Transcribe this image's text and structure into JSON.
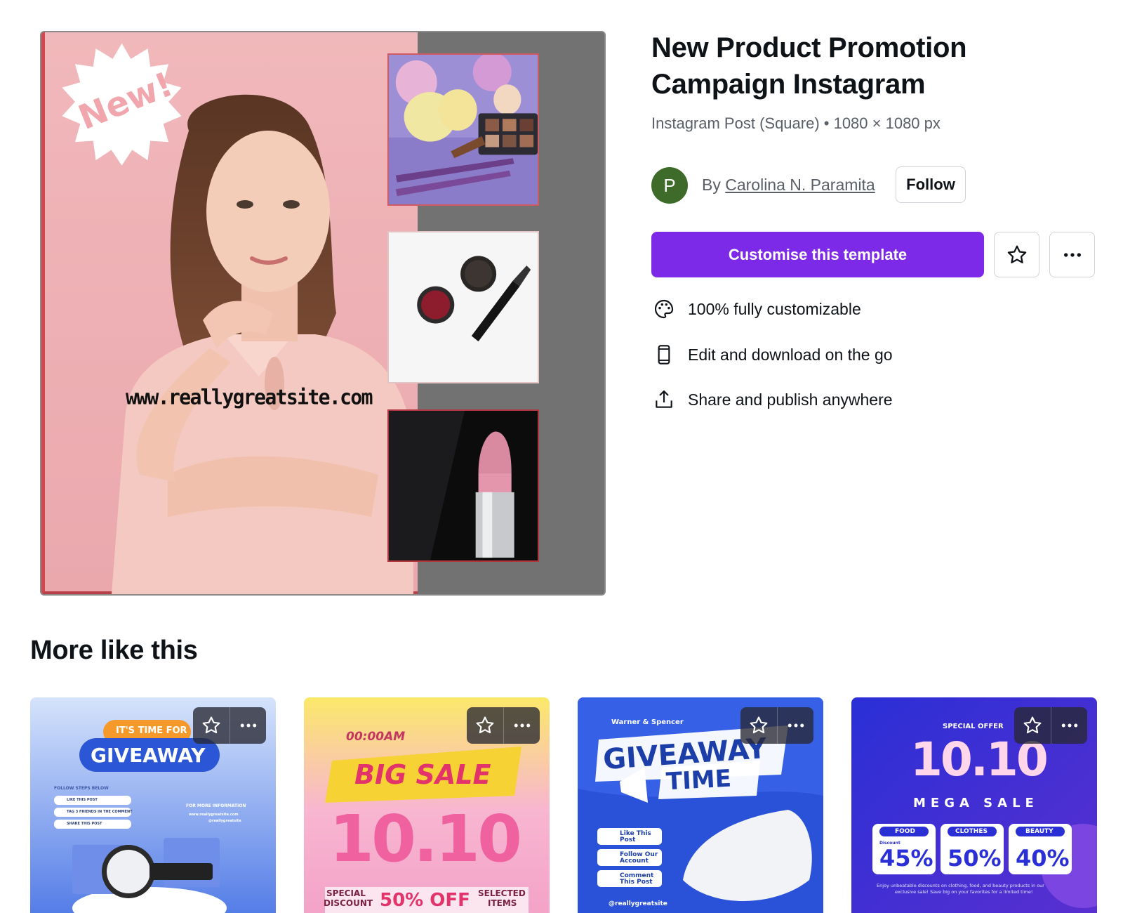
{
  "template": {
    "title": "New Product Promotion Campaign Instagram",
    "subtitle": "Instagram Post (Square) • 1080 × 1080 px",
    "author_initial": "P",
    "by_label": "By",
    "author_name": "Carolina N. Paramita",
    "follow_label": "Follow",
    "customise_label": "Customise this template",
    "star_icon": "star-icon",
    "more_icon": "more-icon"
  },
  "preview": {
    "badge_text": "New!",
    "website": "www.reallygreatsite.com"
  },
  "features": [
    {
      "icon": "palette-icon",
      "label": "100% fully customizable"
    },
    {
      "icon": "phone-icon",
      "label": "Edit and download on the go"
    },
    {
      "icon": "share-icon",
      "label": "Share and publish anywhere"
    }
  ],
  "more_like_this": {
    "heading": "More like this",
    "cards": [
      {
        "name": "Giveaway watch",
        "lines": [
          "IT'S TIME FOR",
          "GIVEAWAY",
          "FOLLOW STEPS BELOW",
          "LIKE THIS POST",
          "TAG 3 FRIENDS IN THE COMMENT",
          "SHARE THIS POST",
          "FOR MORE INFORMATION",
          "www.reallygreatsite.com",
          "@reallygreatsite"
        ]
      },
      {
        "name": "Big sale 10.10",
        "lines": [
          "00:00AM",
          "BIG SALE",
          "10.10",
          "SPECIAL",
          "DISCOUNT",
          "50% OFF",
          "SELECTED",
          "ITEMS"
        ]
      },
      {
        "name": "Giveaway time",
        "lines": [
          "Warner & Spencer",
          "GIVEAWAY",
          "TIME",
          "Like This",
          "Post",
          "Follow Our",
          "Account",
          "Comment",
          "This Post",
          "@reallygreatsite"
        ]
      },
      {
        "name": "10.10 mega sale",
        "lines": [
          "SPECIAL OFFER",
          "10.10",
          "MEGA SALE",
          "FOOD",
          "CLOTHES",
          "BEAUTY",
          "Discount",
          "45%",
          "50%",
          "40%",
          "Enjoy unbeatable discounts on clothing, food, and beauty products in our",
          "exclusive sale! Save big on your favorites for a limited time!"
        ]
      }
    ]
  },
  "colors": {
    "accent": "#7d2ae8",
    "avatar": "#3e6b2a",
    "preview_pink": "#f1b8bb"
  }
}
